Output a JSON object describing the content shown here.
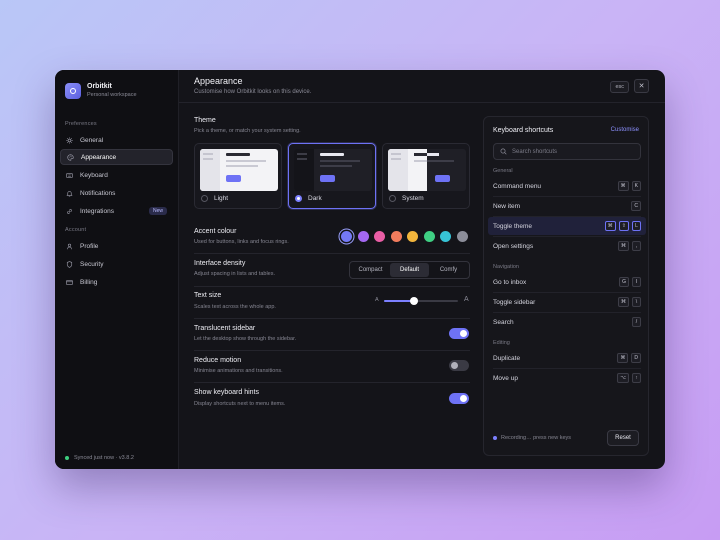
{
  "brand": {
    "name": "Orbitkit",
    "subtitle": "Personal workspace",
    "icon": "orbit-logo-icon"
  },
  "sidebar": {
    "preferences_label": "Preferences",
    "preferences": [
      {
        "label": "General",
        "icon": "sun-icon"
      },
      {
        "label": "Appearance",
        "icon": "palette-icon",
        "active": true
      },
      {
        "label": "Keyboard",
        "icon": "keyboard-icon"
      },
      {
        "label": "Notifications",
        "icon": "bell-icon"
      },
      {
        "label": "Integrations",
        "icon": "link-icon",
        "badge": "New"
      }
    ],
    "account_label": "Account",
    "account": [
      {
        "label": "Profile",
        "icon": "user-icon"
      },
      {
        "label": "Security",
        "icon": "shield-icon"
      },
      {
        "label": "Billing",
        "icon": "credit-card-icon"
      }
    ],
    "sync_status": "Synced just now · v3.8.2",
    "sync_color": "#3ecf7f"
  },
  "header": {
    "title": "Appearance",
    "subtitle": "Customise how Orbitkit looks on this device.",
    "esc_label": "esc",
    "close_icon": "close-icon"
  },
  "theme": {
    "label": "Theme",
    "description": "Pick a theme, or match your system setting.",
    "options": [
      {
        "label": "Light",
        "selected": false
      },
      {
        "label": "Dark",
        "selected": true
      },
      {
        "label": "System",
        "selected": false
      }
    ]
  },
  "accent": {
    "label": "Accent colour",
    "description": "Used for buttons, links and focus rings.",
    "colors": [
      "#7479f6",
      "#a468f2",
      "#ea5ea6",
      "#f37c5d",
      "#f2b53c",
      "#3fcf83",
      "#37c3d6",
      "#8c8d99"
    ],
    "selected_index": 0
  },
  "density": {
    "label": "Interface density",
    "description": "Adjust spacing in lists and tables.",
    "options": [
      "Compact",
      "Default",
      "Comfy"
    ],
    "selected": "Default"
  },
  "text_size": {
    "label": "Text size",
    "description": "Scales text across the whole app.",
    "min_glyph": "A",
    "max_glyph": "A",
    "value_fraction": 0.4
  },
  "toggles": [
    {
      "label": "Translucent sidebar",
      "description": "Let the desktop show through the sidebar.",
      "on": true
    },
    {
      "label": "Reduce motion",
      "description": "Minimise animations and transitions.",
      "on": false
    },
    {
      "label": "Show keyboard hints",
      "description": "Display shortcuts next to menu items.",
      "on": true
    }
  ],
  "shortcuts": {
    "title": "Keyboard shortcuts",
    "customise_label": "Customise",
    "search_placeholder": "Search shortcuts",
    "groups": [
      {
        "label": "General",
        "items": [
          {
            "label": "Command menu",
            "keys": [
              "⌘",
              "K"
            ]
          },
          {
            "label": "New item",
            "keys": [
              "C"
            ]
          },
          {
            "label": "Toggle theme",
            "keys": [
              "⌘",
              "⇧",
              "L"
            ],
            "highlight": true
          },
          {
            "label": "Open settings",
            "keys": [
              "⌘",
              ","
            ]
          }
        ]
      },
      {
        "label": "Navigation",
        "items": [
          {
            "label": "Go to inbox",
            "keys": [
              "G",
              "I"
            ]
          },
          {
            "label": "Toggle sidebar",
            "keys": [
              "⌘",
              "\\"
            ]
          },
          {
            "label": "Search",
            "keys": [
              "/"
            ]
          }
        ]
      },
      {
        "label": "Editing",
        "items": [
          {
            "label": "Duplicate",
            "keys": [
              "⌘",
              "D"
            ]
          },
          {
            "label": "Move up",
            "keys": [
              "⌥",
              "↑"
            ]
          }
        ]
      }
    ],
    "recording_text": "Recording… press new keys",
    "reset_label": "Reset"
  }
}
